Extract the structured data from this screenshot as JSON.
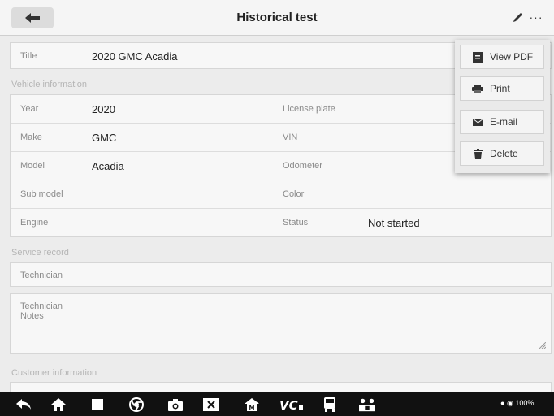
{
  "header": {
    "title": "Historical test"
  },
  "title_row": {
    "label": "Title",
    "value": "2020 GMC Acadia"
  },
  "vehicle_section": {
    "heading": "Vehicle information",
    "left": [
      {
        "label": "Year",
        "value": "2020"
      },
      {
        "label": "Make",
        "value": "GMC"
      },
      {
        "label": "Model",
        "value": "Acadia"
      },
      {
        "label": "Sub model",
        "value": ""
      },
      {
        "label": "Engine",
        "value": ""
      }
    ],
    "right": [
      {
        "label": "License plate",
        "value": ""
      },
      {
        "label": "VIN",
        "value": ""
      },
      {
        "label": "Odometer",
        "value": ""
      },
      {
        "label": "Color",
        "value": ""
      },
      {
        "label": "Status",
        "value": "Not started"
      }
    ]
  },
  "service_section": {
    "heading": "Service record",
    "technician_label": "Technician",
    "notes_label_line1": "Technician",
    "notes_label_line2": "Notes"
  },
  "customer_section": {
    "heading": "Customer information"
  },
  "menu": {
    "items": [
      {
        "label": "View PDF",
        "icon": "pdf-icon"
      },
      {
        "label": "Print",
        "icon": "printer-icon"
      },
      {
        "label": "E-mail",
        "icon": "mail-icon"
      },
      {
        "label": "Delete",
        "icon": "trash-icon"
      }
    ]
  },
  "navbar": {
    "icons": [
      "back-icon",
      "home-icon",
      "recent-apps-icon",
      "chrome-icon",
      "camera-icon",
      "screenshot-icon",
      "maxifix-icon",
      "vci-icon",
      "vehicle-icon",
      "remote-icon"
    ],
    "status_text": "100%"
  },
  "colors": {
    "background": "#ececec",
    "navbar": "#111111",
    "accent": "#333333"
  }
}
